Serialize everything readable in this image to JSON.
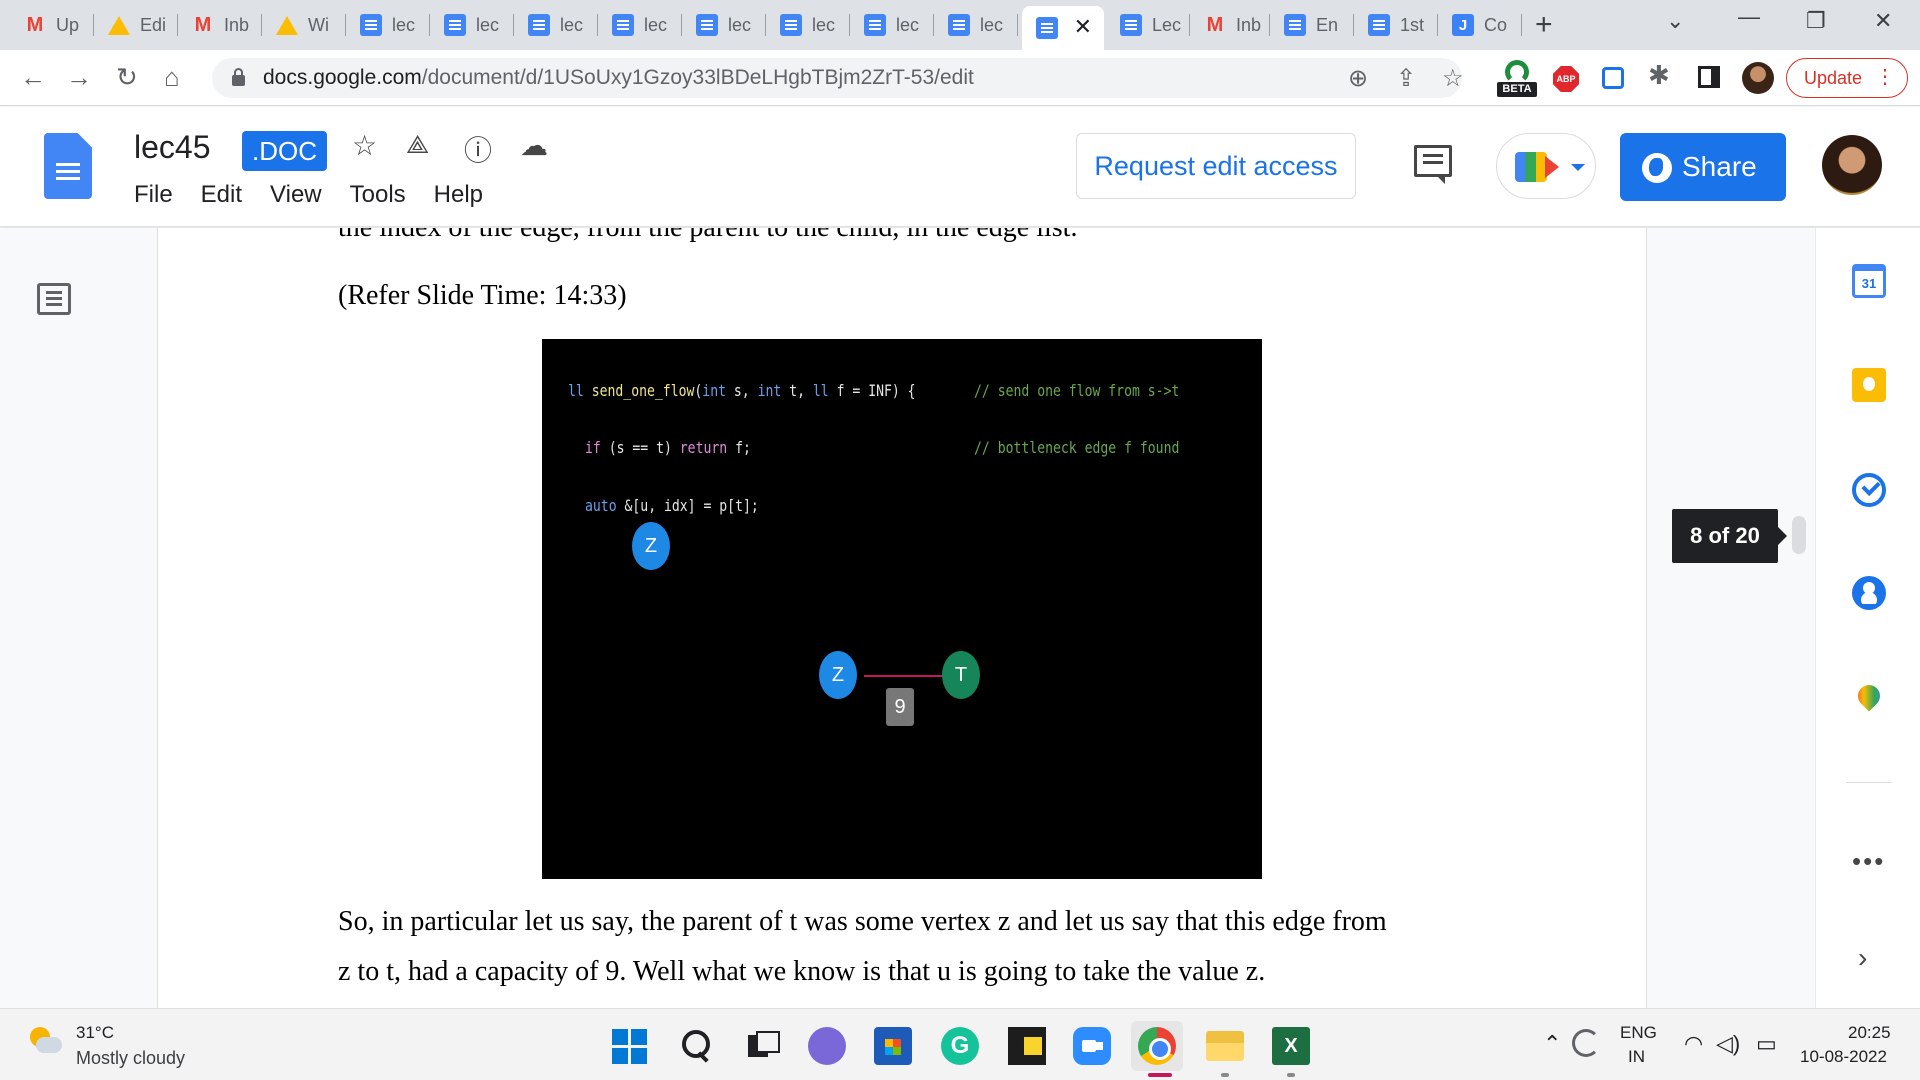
{
  "browser": {
    "tabs": [
      {
        "label": "Up",
        "icon": "gmail-icon"
      },
      {
        "label": "Edi",
        "icon": "drive-icon"
      },
      {
        "label": "Inb",
        "icon": "gmail-icon"
      },
      {
        "label": "Wi",
        "icon": "drive-icon"
      },
      {
        "label": "lec",
        "icon": "docs-icon"
      },
      {
        "label": "lec",
        "icon": "docs-icon"
      },
      {
        "label": "lec",
        "icon": "docs-icon"
      },
      {
        "label": "lec",
        "icon": "docs-icon"
      },
      {
        "label": "lec",
        "icon": "docs-icon"
      },
      {
        "label": "lec",
        "icon": "docs-icon"
      },
      {
        "label": "lec",
        "icon": "docs-icon"
      },
      {
        "label": "lec",
        "icon": "docs-icon"
      },
      {
        "label": "",
        "icon": "docs-icon",
        "active": true
      },
      {
        "label": "Lec",
        "icon": "docs-icon"
      },
      {
        "label": "Inb",
        "icon": "gmail-icon"
      },
      {
        "label": "En",
        "icon": "docs-icon"
      },
      {
        "label": "1st",
        "icon": "docs-icon"
      },
      {
        "label": "Co",
        "icon": "jamboard-icon"
      }
    ],
    "url_host": "docs.google.com",
    "url_path": "/document/d/1USoUxy1Gzoy33lBDeLHgbTBjm2ZrT-53/edit",
    "beta_label": "BETA",
    "abp_label": "ABP",
    "update_label": "Update"
  },
  "docs": {
    "title": "lec45",
    "badge": ".DOC",
    "menu": [
      "File",
      "Edit",
      "View",
      "Tools",
      "Help"
    ],
    "request_access_label": "Request edit access",
    "share_label": "Share"
  },
  "document": {
    "para_top": "the index of the edge, from the parent to the child, in the edge list.",
    "para_slide_ref": "(Refer Slide Time: 14:33)",
    "para_bottom_1": "So, in particular let us say, the parent of t was some vertex z and let us say that this edge from",
    "para_bottom_2": "z to t, had a capacity of 9. Well what we know is that u is going to take the value z."
  },
  "slide": {
    "code_line_1": {
      "type": "ll",
      "fn": "send_one_flow",
      "p1": "(",
      "int1": "int",
      "p2": " s, ",
      "int2": "int",
      "p3": " t, ",
      "ll2": "ll",
      "p4": " f = INF) {",
      "comment": "// send one flow from s->t"
    },
    "code_line_2": {
      "if": "if",
      "cond": " (s == t) ",
      "ret": "return",
      "rest": " f;",
      "comment": "// bottleneck edge f found"
    },
    "code_line_3": {
      "auto": "auto",
      "rest": " &[u, idx] = p[t];"
    },
    "node_z_top": "Z",
    "node_z": "Z",
    "node_t": "T",
    "edge_weight": "9"
  },
  "page_counter": "8 of 20",
  "side_panel": {
    "calendar_day": "31"
  },
  "taskbar": {
    "temperature": "31°C",
    "weather": "Mostly cloudy",
    "lang_1": "ENG",
    "lang_2": "IN",
    "time": "20:25",
    "date": "10-08-2022"
  }
}
